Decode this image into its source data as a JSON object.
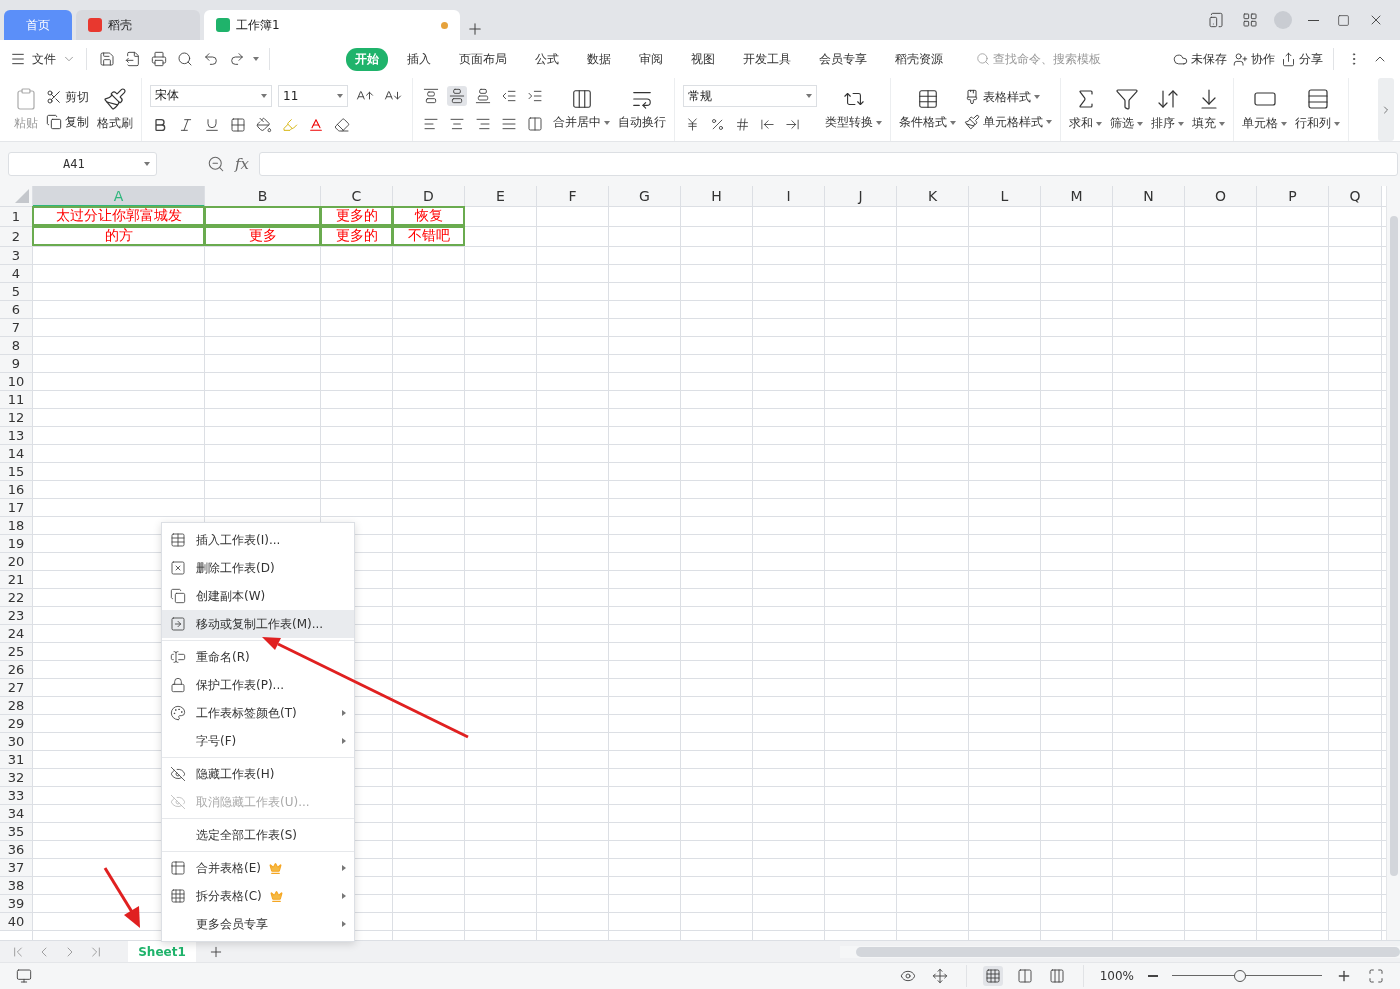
{
  "doc_tabs": [
    {
      "label": "首页",
      "kind": "home",
      "selected": false
    },
    {
      "label": "稻壳",
      "kind": "docer",
      "selected": false
    },
    {
      "label": "工作簿1",
      "kind": "sheet",
      "selected": true,
      "unsaved": true
    }
  ],
  "menu": {
    "file": "文件",
    "tabs": [
      {
        "label": "开始",
        "selected": true
      },
      {
        "label": "插入",
        "selected": false
      },
      {
        "label": "页面布局",
        "selected": false
      },
      {
        "label": "公式",
        "selected": false
      },
      {
        "label": "数据",
        "selected": false
      },
      {
        "label": "审阅",
        "selected": false
      },
      {
        "label": "视图",
        "selected": false
      },
      {
        "label": "开发工具",
        "selected": false
      },
      {
        "label": "会员专享",
        "selected": false
      },
      {
        "label": "稻壳资源",
        "selected": false
      }
    ],
    "search": {
      "placeholder": "查找命令、搜索模板"
    },
    "actions": [
      "未保存",
      "协作",
      "分享"
    ]
  },
  "ribbon": {
    "clipboard": {
      "paste": {
        "label": "粘贴",
        "disabled": true
      },
      "cut": "剪切",
      "copy": "复制",
      "format_painter": "格式刷"
    },
    "font": {
      "name": "宋体",
      "size": "11"
    },
    "alignment": {
      "vertical": [
        {
          "selected": false
        },
        {
          "selected": true
        },
        {
          "selected": false
        }
      ],
      "merge": "合并居中",
      "wrap": "自动换行"
    },
    "number": {
      "format": "常规",
      "convert": "类型转换"
    },
    "styles": {
      "conditional": "条件格式",
      "table_style": "表格样式",
      "cell_style": "单元格样式"
    },
    "editing": [
      "求和",
      "筛选",
      "排序",
      "填充"
    ],
    "cells": [
      "单元格",
      "行和列"
    ]
  },
  "name_box": "A41",
  "formula": {
    "fx": "fx"
  },
  "columns": [
    {
      "label": "A",
      "selected": true
    },
    {
      "label": "B",
      "selected": false
    },
    {
      "label": "C",
      "selected": false
    },
    {
      "label": "D",
      "selected": false
    },
    {
      "label": "E",
      "selected": false
    },
    {
      "label": "F",
      "selected": false
    },
    {
      "label": "G",
      "selected": false
    },
    {
      "label": "H",
      "selected": false
    },
    {
      "label": "I",
      "selected": false
    },
    {
      "label": "J",
      "selected": false
    },
    {
      "label": "K",
      "selected": false
    },
    {
      "label": "L",
      "selected": false
    },
    {
      "label": "M",
      "selected": false
    },
    {
      "label": "N",
      "selected": false
    },
    {
      "label": "O",
      "selected": false
    },
    {
      "label": "P",
      "selected": false
    },
    {
      "label": "Q",
      "selected": false
    }
  ],
  "row_numbers": [
    "1",
    "2",
    "3",
    "4",
    "5",
    "6",
    "7",
    "8",
    "9",
    "10",
    "11",
    "12",
    "13",
    "14",
    "15",
    "16",
    "17",
    "18",
    "19",
    "20",
    "21",
    "22",
    "23",
    "24",
    "25",
    "26",
    "27",
    "28",
    "29",
    "30",
    "31",
    "32",
    "33",
    "34",
    "35",
    "36",
    "37",
    "38",
    "39",
    "40"
  ],
  "data_rows": [
    [
      "太过分让你郭富城发",
      null,
      "更多的",
      "恢复"
    ],
    [
      "的方",
      "更多",
      "更多的",
      "不错吧"
    ]
  ],
  "context_menu": {
    "groups": [
      [
        {
          "label": "插入工作表(I)...",
          "submenu": false,
          "premium": false,
          "disabled": false,
          "selected": false
        },
        {
          "label": "删除工作表(D)",
          "submenu": false,
          "premium": false,
          "disabled": false,
          "selected": false
        },
        {
          "label": "创建副本(W)",
          "submenu": false,
          "premium": false,
          "disabled": false,
          "selected": false
        },
        {
          "label": "移动或复制工作表(M)...",
          "submenu": false,
          "premium": false,
          "disabled": false,
          "selected": true
        }
      ],
      [
        {
          "label": "重命名(R)",
          "submenu": false,
          "premium": false,
          "disabled": false,
          "selected": false
        },
        {
          "label": "保护工作表(P)...",
          "submenu": false,
          "premium": false,
          "disabled": false,
          "selected": false
        },
        {
          "label": "工作表标签颜色(T)",
          "submenu": true,
          "premium": false,
          "disabled": false,
          "selected": false
        },
        {
          "label": "字号(F)",
          "submenu": true,
          "premium": false,
          "disabled": false,
          "selected": false
        }
      ],
      [
        {
          "label": "隐藏工作表(H)",
          "submenu": false,
          "premium": false,
          "disabled": false,
          "selected": false
        },
        {
          "label": "取消隐藏工作表(U)...",
          "submenu": false,
          "premium": false,
          "disabled": true,
          "selected": false
        }
      ],
      [
        {
          "label": "选定全部工作表(S)",
          "submenu": false,
          "premium": false,
          "disabled": false,
          "selected": false
        }
      ],
      [
        {
          "label": "合并表格(E)",
          "submenu": true,
          "premium": true,
          "disabled": false,
          "selected": false
        },
        {
          "label": "拆分表格(C)",
          "submenu": true,
          "premium": true,
          "disabled": false,
          "selected": false
        },
        {
          "label": "更多会员专享",
          "submenu": true,
          "premium": false,
          "disabled": false,
          "selected": false
        }
      ]
    ]
  },
  "sheet_tabs": [
    {
      "label": "Sheet1",
      "selected": true
    }
  ],
  "status": {
    "view_modes": [
      {
        "selected": true
      },
      {
        "selected": false
      },
      {
        "selected": false
      }
    ],
    "zoom": {
      "label": "100%",
      "level": 0.45
    }
  }
}
